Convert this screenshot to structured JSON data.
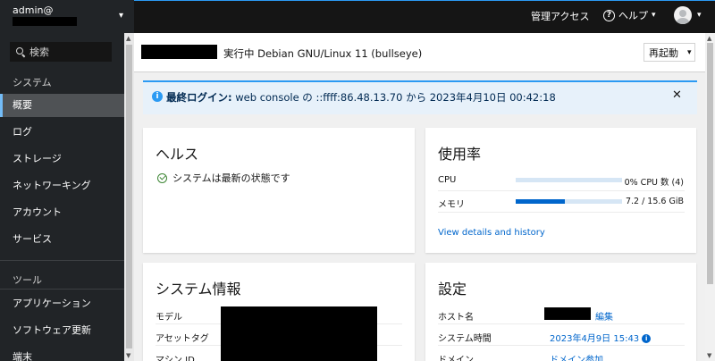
{
  "host": {
    "user": "admin@",
    "chevron": "▾"
  },
  "topbar": {
    "admin_access": "管理アクセス",
    "help_label": "ヘルプ",
    "help_icon": "?",
    "caret": "▾"
  },
  "sidebar": {
    "search_placeholder": "検索",
    "sections": [
      {
        "label": "システム"
      },
      {
        "label": "ツール"
      }
    ],
    "items": [
      {
        "label": "概要",
        "active": true
      },
      {
        "label": "ログ"
      },
      {
        "label": "ストレージ"
      },
      {
        "label": "ネットワーキング"
      },
      {
        "label": "アカウント"
      },
      {
        "label": "サービス"
      },
      {
        "label": "アプリケーション"
      },
      {
        "label": "ソフトウェア更新"
      },
      {
        "label": "端末"
      }
    ]
  },
  "page_header": {
    "title": "実行中 Debian GNU/Linux 11 (bullseye)",
    "restart_label": "再起動",
    "restart_caret": "▾"
  },
  "alert": {
    "icon": "i",
    "title": "最終ログイン:",
    "text": "web console の ::ffff:86.48.13.70 から 2023年4月10日 00:42:18",
    "close": "✕"
  },
  "health": {
    "title": "ヘルス",
    "status": "システムは最新の状態です"
  },
  "usage": {
    "title": "使用率",
    "rows": [
      {
        "label": "CPU",
        "value": "0% CPU 数 (4)",
        "fraction": 0.0
      },
      {
        "label": "メモリ",
        "value": "7.2 / 15.6 GiB",
        "fraction": 0.46
      }
    ],
    "link": "View details and history",
    "colors": {
      "fill": "#0066cc",
      "track": "#d6e6f5"
    }
  },
  "sysinfo": {
    "title": "システム情報",
    "rows": [
      {
        "label": "モデル"
      },
      {
        "label": "アセットタグ"
      },
      {
        "label": "マシン ID"
      }
    ]
  },
  "settings": {
    "title": "設定",
    "rows": [
      {
        "label": "ホスト名",
        "value": "編集"
      },
      {
        "label": "システム時間",
        "value": "2023年4月9日 15:43"
      },
      {
        "label": "ドメイン",
        "value": "ドメイン参加"
      }
    ],
    "info_icon": "i"
  },
  "colors": {
    "accent": "#0066cc",
    "topbar": "#151515",
    "sidebar": "#212427",
    "success": "#3e8635",
    "info": "#2b9af3"
  }
}
